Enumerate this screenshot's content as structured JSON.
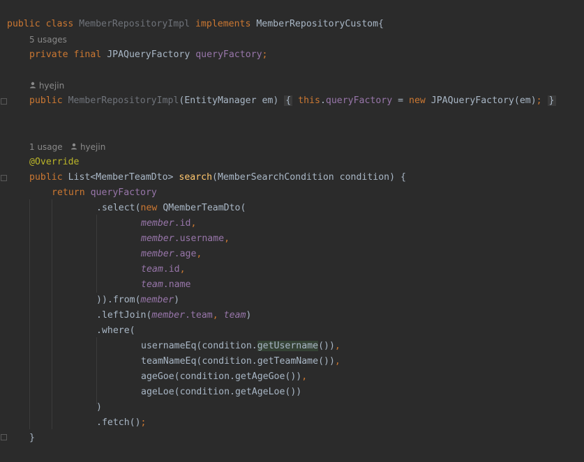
{
  "editor": {
    "line1": {
      "kw1": "public",
      "kw2": "class",
      "cls": "MemberRepositoryImpl",
      "kw3": "implements",
      "iface": "MemberRepositoryCustom",
      "brace": "{"
    },
    "hint1": {
      "usages": "5 usages"
    },
    "line2": {
      "kw1": "private",
      "kw2": "final",
      "type": "JPAQueryFactory",
      "name": "queryFactory",
      "semi": ";"
    },
    "hint2": {
      "author": "hyejin"
    },
    "line3": {
      "kw1": "public",
      "ctor": "MemberRepositoryImpl",
      "params": "(EntityManager em)",
      "open": "{",
      "this": "this",
      "dot": ".",
      "field": "queryFactory",
      "eq": " = ",
      "new": "new",
      "call": "JPAQueryFactory(em)",
      "semi": ";",
      "close": "}"
    },
    "hint3": {
      "usages": "1 usage",
      "author": "hyejin"
    },
    "line4": {
      "anno": "@Override"
    },
    "line5": {
      "kw": "public",
      "ret": "List<MemberTeamDto>",
      "method": "search",
      "params": "(MemberSearchCondition condition) {"
    },
    "line6": {
      "kw": "return",
      "field": "queryFactory"
    },
    "line7": {
      "pre": ".select(",
      "new": "new",
      "post": "QMemberTeamDto("
    },
    "line8": {
      "obj": "member",
      "prop": ".id",
      "comma": ","
    },
    "line9": {
      "obj": "member",
      "prop": ".username",
      "comma": ","
    },
    "line10": {
      "obj": "member",
      "prop": ".age",
      "comma": ","
    },
    "line11": {
      "obj": "team",
      "prop": ".id",
      "comma": ","
    },
    "line12": {
      "obj": "team",
      "prop": ".name"
    },
    "line13": {
      "pre": ")).from(",
      "obj": "member",
      "post": ")"
    },
    "line14": {
      "pre": ".leftJoin(",
      "obj": "member",
      "prop": ".team",
      "comma": ", ",
      "obj2": "team",
      "post": ")"
    },
    "line15": {
      "text": ".where("
    },
    "line16": {
      "pre": "usernameEq(condition.",
      "hl": "getUsername",
      "post": "())",
      "comma": ","
    },
    "line17": {
      "text": "teamNameEq(condition.getTeamName())",
      "comma": ","
    },
    "line18": {
      "text": "ageGoe(condition.getAgeGoe())",
      "comma": ","
    },
    "line19": {
      "text": "ageLoe(condition.getAgeLoe())"
    },
    "line20": {
      "text": ")"
    },
    "line21": {
      "text": ".fetch()",
      "semi": ";"
    },
    "line22": {
      "text": "}"
    }
  },
  "colors": {
    "background": "#2b2b2b",
    "keyword": "#cc7832",
    "field": "#9876aa",
    "method": "#ffc66d",
    "annotation": "#bbb529",
    "text": "#a9b7c6"
  }
}
